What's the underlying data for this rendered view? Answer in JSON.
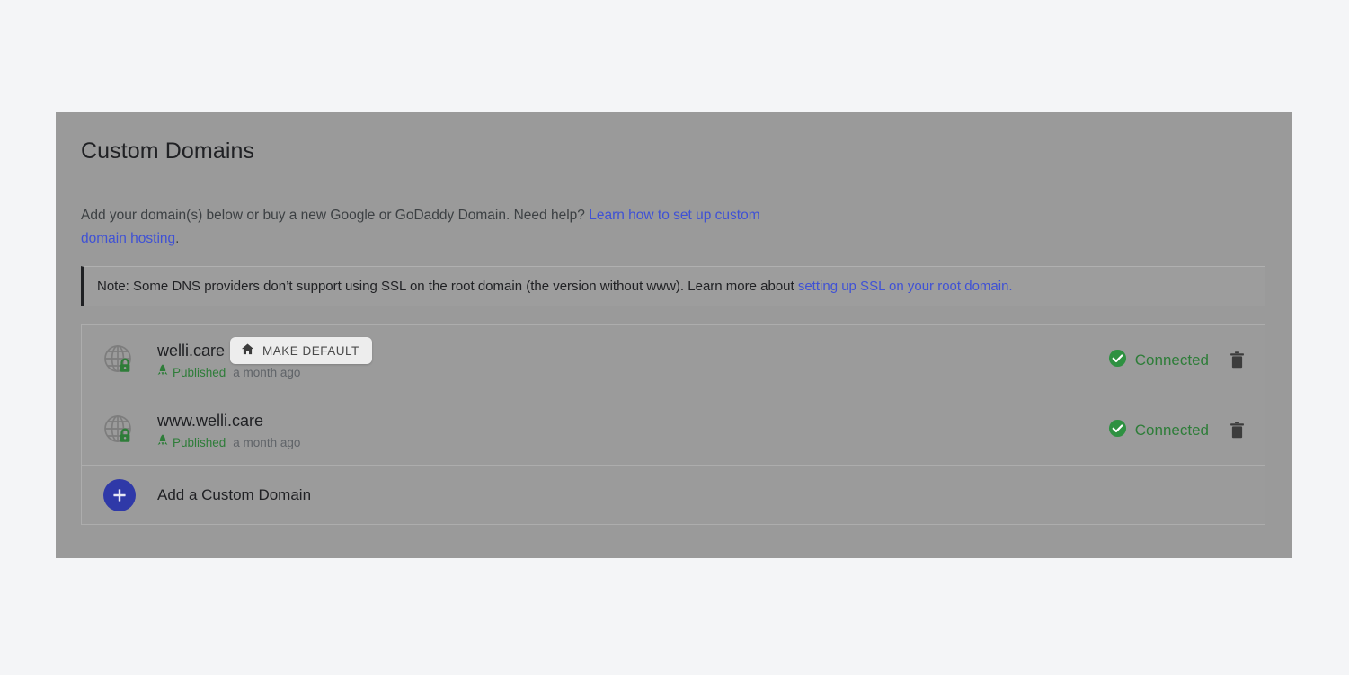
{
  "page": {
    "background_color": "#f4f5f7",
    "panel_color": "#9a9a9a"
  },
  "header": {
    "title": "Custom Domains"
  },
  "intro": {
    "text_before": "Add your domain(s) below or buy a new Google or GoDaddy Domain. Need help? ",
    "link_text": "Learn how to set up custom domain hosting",
    "text_after": "."
  },
  "note": {
    "text_before": "Note: Some DNS providers don’t support using SSL on the root domain (the version without www). Learn more about ",
    "link_text": "setting up SSL on your root domain.",
    "accent_color": "#1f2023"
  },
  "domains": [
    {
      "icon": "globe-lock-icon",
      "name": "welli.care",
      "make_default_label": "MAKE DEFAULT",
      "make_default_icon": "home-icon",
      "status_icon": "rocket-icon",
      "status_label": "Published",
      "timeago": "a month ago",
      "connection_icon": "check-circle-icon",
      "connection_label": "Connected",
      "delete_icon": "trash-icon"
    },
    {
      "icon": "globe-lock-icon",
      "name": "www.welli.care",
      "status_icon": "rocket-icon",
      "status_label": "Published",
      "timeago": "a month ago",
      "connection_icon": "check-circle-icon",
      "connection_label": "Connected",
      "delete_icon": "trash-icon"
    }
  ],
  "add_row": {
    "icon": "plus-icon",
    "label": "Add a Custom Domain",
    "button_color": "#2f39a8"
  },
  "colors": {
    "link": "#3f51d5",
    "success": "#2e7d39",
    "accent": "#2f39a8"
  }
}
